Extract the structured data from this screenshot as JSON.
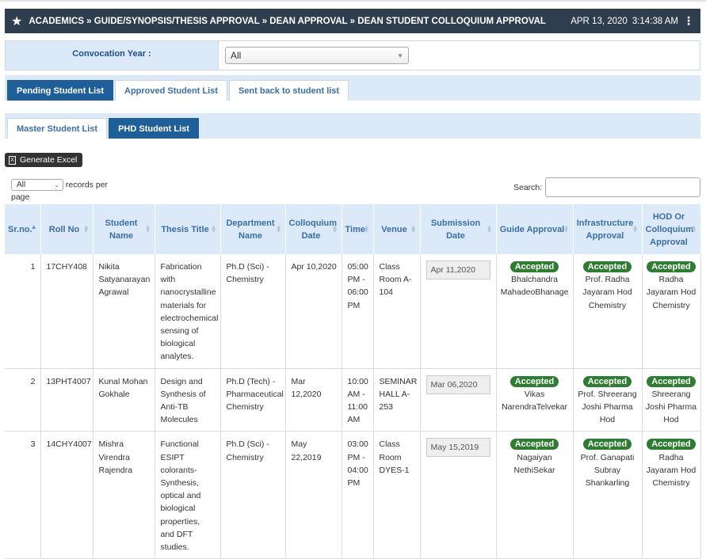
{
  "header": {
    "breadcrumb": "ACADEMICS » GUIDE/SYNOPSIS/THESIS APPROVAL » DEAN APPROVAL » DEAN STUDENT COLLOQUIUM APPROVAL",
    "date": "APR 13, 2020",
    "time": "3:14:38 AM"
  },
  "filter": {
    "label": "Convocation Year :",
    "value": "All"
  },
  "tabs_primary": [
    "Pending Student List",
    "Approved Student List",
    "Sent back to student list"
  ],
  "tabs_secondary": [
    "Master Student List",
    "PHD Student List"
  ],
  "excel_button": "Generate Excel",
  "length": {
    "value": "All",
    "label_a": "records per",
    "label_b": "page"
  },
  "search": {
    "label": "Search:",
    "value": ""
  },
  "columns": [
    "Sr.no.",
    "Roll No",
    "Student Name",
    "Thesis Title",
    "Department Name",
    "Colloquium Date",
    "Time",
    "Venue",
    "Submission Date",
    "Guide Approval",
    "Infrastructure Approval",
    "HOD Or Colloquium Approval"
  ],
  "rows": [
    {
      "sr": "1",
      "roll": "17CHY408",
      "name": "Nikita Satyanarayan Agrawal",
      "thesis": "Fabrication with nanocrystalline materials for electrochemical sensing of biological analytes.",
      "dept": "Ph.D (Sci) - Chemistry",
      "colloquium": "Apr 10,2020",
      "time": "05:00 PM - 06:00 PM",
      "venue": "Class Room A-104",
      "submission": "Apr 11,2020",
      "guide_status": "Accepted",
      "guide_name": "Bhalchandra MahadeoBhanage",
      "infra_status": "Accepted",
      "infra_name": "Prof. Radha Jayaram Hod Chemistry",
      "hod_status": "Accepted",
      "hod_name": "Radha Jayaram Hod Chemistry"
    },
    {
      "sr": "2",
      "roll": "13PHT4007",
      "name": "Kunal Mohan Gokhale",
      "thesis": "Design and Synthesis of Anti-TB Molecules",
      "dept": "Ph.D (Tech) - Pharmaceutical Chemistry",
      "colloquium": "Mar 12,2020",
      "time": "10:00 AM - 11:00 AM",
      "venue": "SEMINAR HALL A-253",
      "submission": "Mar 06,2020",
      "guide_status": "Accepted",
      "guide_name": "Vikas NarendraTelvekar",
      "infra_status": "Accepted",
      "infra_name": "Prof. Shreerang Joshi Pharma Hod",
      "hod_status": "Accepted",
      "hod_name": "Shreerang Joshi Pharma Hod"
    },
    {
      "sr": "3",
      "roll": "14CHY4007",
      "name": "Mishra Virendra Rajendra",
      "thesis": "Functional ESIPT colorants-Synthesis, optical and biological properties, and DFT studies.",
      "dept": "Ph.D (Sci) - Chemistry",
      "colloquium": "May 22,2019",
      "time": "03:00 PM - 04:00 PM",
      "venue": "Class Room DYES-1",
      "submission": "May 15,2019",
      "guide_status": "Accepted",
      "guide_name": "Nagaiyan NethiSekar",
      "infra_status": "Accepted",
      "infra_name": "Prof. Ganapati Subray Shankarling",
      "hod_status": "Accepted",
      "hod_name": "Radha Jayaram Hod Chemistry"
    }
  ]
}
